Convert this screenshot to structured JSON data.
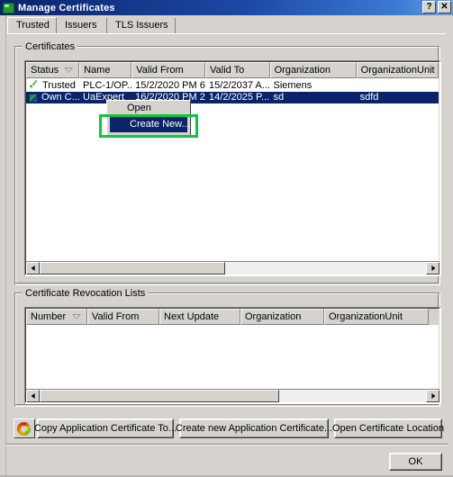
{
  "window": {
    "title": "Manage Certificates",
    "icon": "certificate-window-icon",
    "help_button": "?",
    "close_button": "✕"
  },
  "tabs": [
    {
      "label": "Trusted",
      "selected": true
    },
    {
      "label": "Issuers",
      "selected": false
    },
    {
      "label": "TLS Issuers",
      "selected": false
    }
  ],
  "certificates_group": {
    "title": "Certificates",
    "columns": [
      {
        "label": "Status",
        "sorted": true
      },
      {
        "label": "Name",
        "sorted": false
      },
      {
        "label": "Valid From",
        "sorted": false
      },
      {
        "label": "Valid To",
        "sorted": false
      },
      {
        "label": "Organization",
        "sorted": false
      },
      {
        "label": "OrganizationUnit",
        "sorted": false
      }
    ],
    "rows": [
      {
        "status": "Trusted",
        "status_icon": "green-check-icon",
        "name": "PLC-1/OP...",
        "valid_from": "15/2/2020 PM 6...",
        "valid_to": "15/2/2037 A...",
        "organization": "Siemens",
        "organization_unit": "",
        "selected": false
      },
      {
        "status": "Own C...",
        "status_icon": "certificate-icon",
        "name": "UaExpert",
        "valid_from": "16/2/2020 PM 2...",
        "valid_to": "14/2/2025 P...",
        "organization": "sd",
        "organization_unit": "sdfd",
        "selected": true
      }
    ]
  },
  "crl_group": {
    "title": "Certificate Revocation Lists",
    "columns": [
      {
        "label": "Number",
        "sorted": true
      },
      {
        "label": "Valid From",
        "sorted": false
      },
      {
        "label": "Next Update",
        "sorted": false
      },
      {
        "label": "Organization",
        "sorted": false
      },
      {
        "label": "OrganizationUnit",
        "sorted": false
      }
    ],
    "rows": []
  },
  "context_menu": {
    "items": [
      {
        "label": "Open",
        "highlighted": false
      },
      {
        "label": "Create New...",
        "highlighted": true
      }
    ],
    "highlight_color": "#0ec640",
    "selection_color": "#0a246a"
  },
  "action_bar": {
    "refresh_icon": "refresh-icon",
    "buttons": [
      "Copy Application Certificate To...",
      "Create new Application Certificate...",
      "Open Certificate Location"
    ]
  },
  "footer": {
    "ok_label": "OK"
  }
}
